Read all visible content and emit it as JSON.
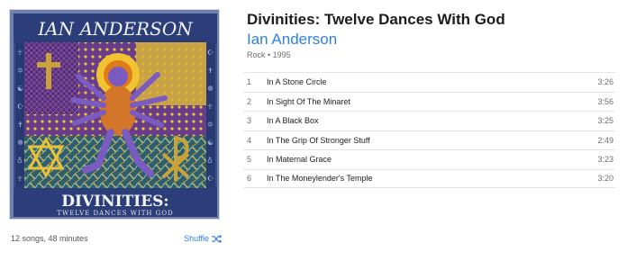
{
  "album": {
    "title": "Divinities: Twelve Dances With God",
    "artist": "Ian Anderson",
    "genre_year": "Rock • 1995",
    "summary": "12 songs, 48 minutes",
    "shuffle_label": "Shuffle",
    "cover": {
      "artist_text": "IAN ANDERSON",
      "title_text": "DIVINITIES:",
      "subtitle_text": "TWELVE DANCES WITH GOD"
    }
  },
  "tracks": [
    {
      "num": "1",
      "name": "In A Stone Circle",
      "duration": "3:26"
    },
    {
      "num": "2",
      "name": "In Sight Of The Minaret",
      "duration": "3:56"
    },
    {
      "num": "3",
      "name": "In A Black Box",
      "duration": "3:25"
    },
    {
      "num": "4",
      "name": "In The Grip Of Stronger Stuff",
      "duration": "2:49"
    },
    {
      "num": "5",
      "name": "In Maternal Grace",
      "duration": "3:23"
    },
    {
      "num": "6",
      "name": "In The Moneylender's Temple",
      "duration": "3:20"
    }
  ],
  "colors": {
    "accent": "#2f7fe3"
  },
  "icons": {
    "shuffle": "shuffle-icon"
  }
}
